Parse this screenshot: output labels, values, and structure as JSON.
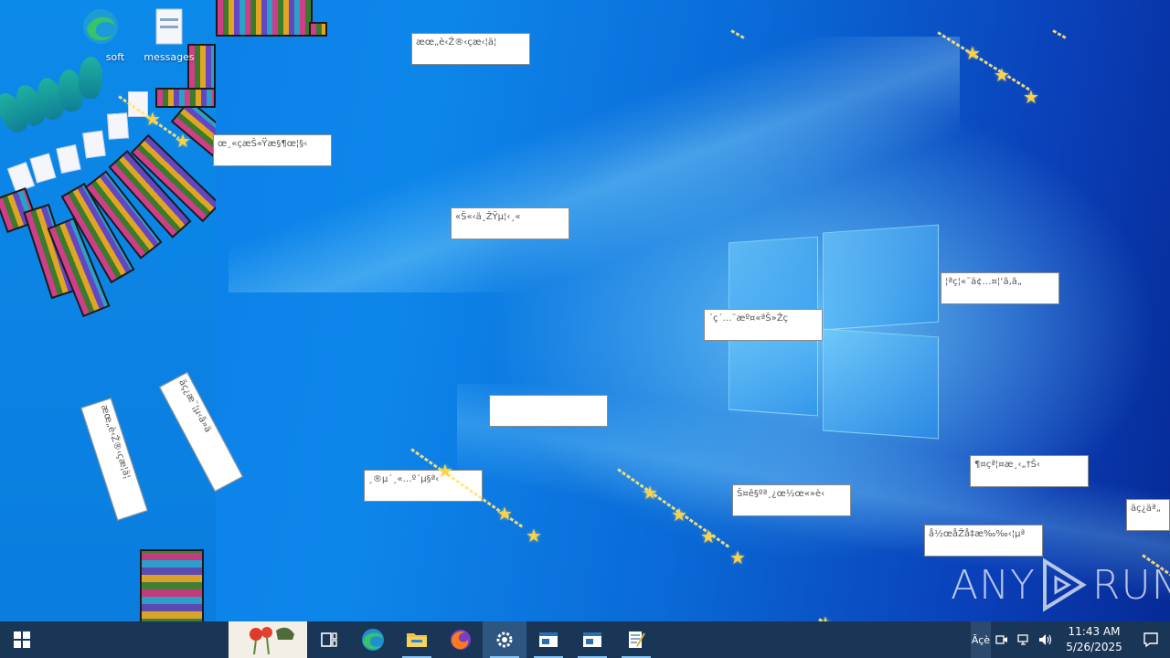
{
  "desktop": {
    "icons": [
      {
        "label": "soft"
      },
      {
        "label": "messages"
      }
    ],
    "labels": [
      {
        "id": "t1",
        "text": "æœ„è‹Ž®‹çæ‹¦ä¦"
      },
      {
        "id": "t2",
        "text": "œ¸«çæŠ«Ÿæ§¶œ¦§‹"
      },
      {
        "id": "t3",
        "text": "«Š«‹ä¸ŽŸµ¦‹¸«"
      },
      {
        "id": "t4",
        "text": "¦ªç¦«˜ä¢…¤¦‘ã‚ã„"
      },
      {
        "id": "t5",
        "text": "´ç´…˜æº¤«ªŠ»Žç"
      },
      {
        "id": "t6",
        "text": ""
      },
      {
        "id": "t7",
        "text": "¸®µ´¸«…º´µ§ª‹"
      },
      {
        "id": "t8",
        "text": "Š¤ê§ºª¸¿œ½œ«»è‹"
      },
      {
        "id": "t9",
        "text": "¶¤çª¦¤æ¸‹„†Š‹"
      },
      {
        "id": "t10",
        "text": "å½œåŽå‡æ‰‰‹¦µª"
      },
      {
        "id": "t11",
        "text": "äç¿äª„"
      },
      {
        "id": "t12",
        "text": "ãç¿æ¨¦µ‹ã»ä"
      },
      {
        "id": "t13",
        "text": "æœ„è‹Ž®‹çæ¦ä¦"
      }
    ]
  },
  "watermark": {
    "text": "ANY",
    "text2": "RUN"
  },
  "taskbar": {
    "items": [
      {
        "name": "start",
        "icon": "windows-logo-icon"
      },
      {
        "name": "task-view",
        "icon": "task-view-icon"
      },
      {
        "name": "edge",
        "icon": "edge-icon"
      },
      {
        "name": "file-explorer",
        "icon": "folder-icon"
      },
      {
        "name": "firefox",
        "icon": "firefox-icon"
      },
      {
        "name": "settings",
        "icon": "gear-icon"
      },
      {
        "name": "window-1",
        "icon": "window-icon"
      },
      {
        "name": "window-2",
        "icon": "window-icon"
      },
      {
        "name": "notepad",
        "icon": "notepad-icon"
      }
    ],
    "tray": {
      "ime": "Ãçè",
      "time": "11:43 AM",
      "date": "5/26/2025"
    }
  },
  "colors": {
    "taskbar_bg": "#1a3656",
    "desktop_blue": "#0b7ee6",
    "star": "#f7d24a"
  }
}
